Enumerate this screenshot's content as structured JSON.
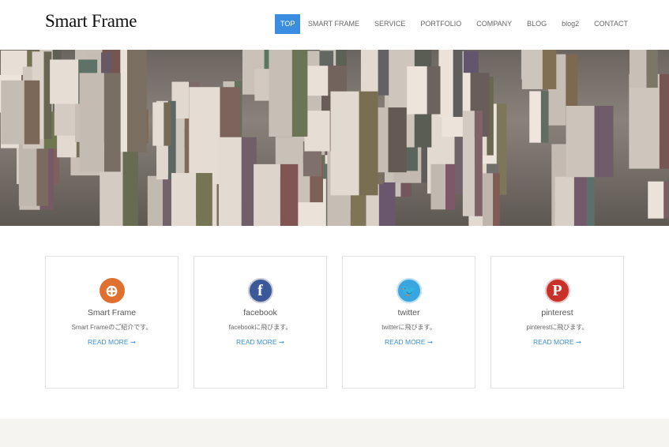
{
  "header": {
    "logo": "Smart Frame",
    "nav": [
      {
        "label": "TOP",
        "active": true
      },
      {
        "label": "SMART FRAME"
      },
      {
        "label": "SERVICE"
      },
      {
        "label": "PORTFOLIO"
      },
      {
        "label": "COMPANY"
      },
      {
        "label": "BLOG"
      },
      {
        "label": "blog2"
      },
      {
        "label": "CONTACT"
      }
    ]
  },
  "hero": {
    "image": "aerial-city-buildings"
  },
  "cards": [
    {
      "title": "Smart Frame",
      "desc": "Smart Frameのご紹介です。",
      "more": "READ MORE ➞",
      "icon": "magnifier-icon",
      "color": "#e0702f"
    },
    {
      "title": "facebook",
      "desc": "facebookに飛びます。",
      "more": "READ MORE ➞",
      "icon": "facebook-icon",
      "color": "#3b5998"
    },
    {
      "title": "twitter",
      "desc": "twitterに飛びます。",
      "more": "READ MORE ➞",
      "icon": "twitter-icon",
      "color": "#3aa6e0"
    },
    {
      "title": "pinterest",
      "desc": "pinterestに飛びます。",
      "more": "READ MORE ➞",
      "icon": "pinterest-icon",
      "color": "#c8302a"
    }
  ],
  "colors": {
    "accent": "#3b8de0"
  }
}
